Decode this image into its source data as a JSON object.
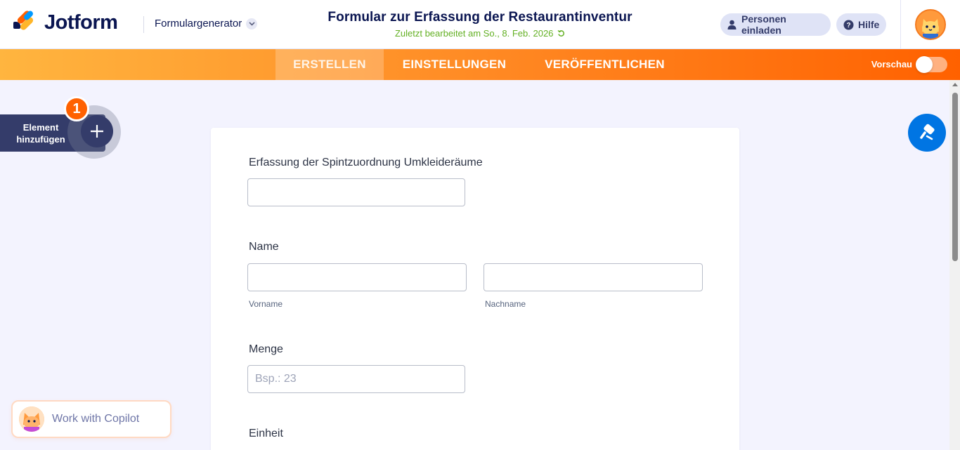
{
  "header": {
    "brand": "Jotform",
    "product_menu": "Formulargenerator",
    "form_title": "Formular zur Erfassung der Restaurantinventur",
    "last_edited": "Zuletzt bearbeitet am So., 8. Feb. 2026",
    "invite_label": "Personen einladen",
    "help_label": "Hilfe",
    "colors": {
      "brand_navy": "#0a1551",
      "edited_green": "#63b023"
    }
  },
  "tabs": {
    "items": [
      {
        "label": "ERSTELLEN",
        "active": true
      },
      {
        "label": "EINSTELLUNGEN",
        "active": false
      },
      {
        "label": "VERÖFFENTLICHEN",
        "active": false
      }
    ],
    "preview_label": "Vorschau",
    "preview_on": false,
    "colors": {
      "gradient_start": "#ffb53f",
      "gradient_end": "#ff6100"
    }
  },
  "sidebar": {
    "add_element_label": "Element hinzufügen",
    "badge_count": "1"
  },
  "form": {
    "fields": [
      {
        "label": "Erfassung der Spintzuordnung Umkleideräume",
        "value": ""
      },
      {
        "label": "Name",
        "first_sublabel": "Vorname",
        "last_sublabel": "Nachname"
      },
      {
        "label": "Menge",
        "placeholder": "Bsp.: 23"
      },
      {
        "label": "Einheit"
      }
    ]
  },
  "copilot": {
    "label": "Work with Copilot"
  },
  "icons": {
    "invite": "person-icon",
    "help": "question-circle-icon",
    "paint": "paint-roller-icon",
    "refresh": "refresh-icon",
    "add": "plus-icon",
    "chevron": "chevron-down-icon"
  },
  "accent_blue": "#0075e3"
}
